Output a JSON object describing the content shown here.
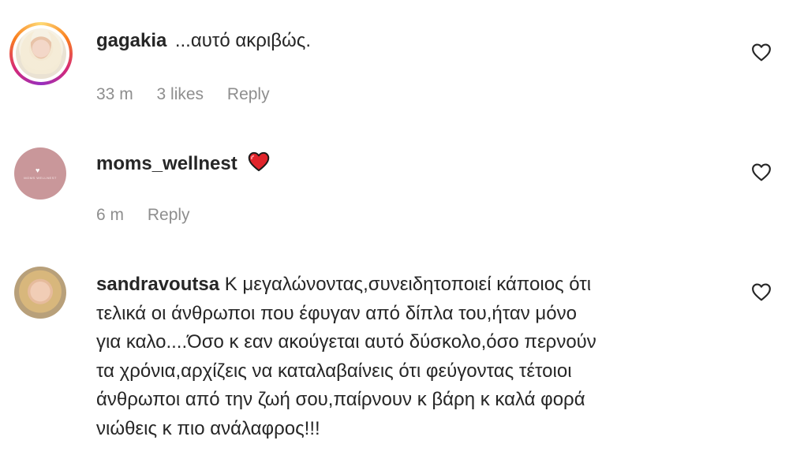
{
  "comments": [
    {
      "username": "gagakia",
      "text": "...αυτό ακριβώς.",
      "time": "33 m",
      "likes": "3 likes",
      "reply": "Reply"
    },
    {
      "username": "moms_wellnest",
      "text": "",
      "emoji": "red-heart-emoji",
      "avatar_logo": "MOMS WELLNEST",
      "time": "6 m",
      "reply": "Reply"
    },
    {
      "username": "sandravoutsa",
      "text_lines": [
        "Κ μεγαλώνοντας,συνειδητοποιεί κάποιος ότι",
        "τελικά οι άνθρωποι που έφυγαν από δίπλα του,ήταν μόνο",
        "για καλο....Όσο κ εαν ακούγεται αυτό δύσκολο,όσο περνούν",
        "τα χρόνια,αρχίζεις να καταλαβαίνεις ότι φεύγοντας τέτοιοι",
        "άνθρωποι από την ζωή σου,παίρνουν κ βάρη κ καλά φορά",
        "νιώθεις κ πιο ανάλαφρος!!!"
      ]
    }
  ],
  "icons": {
    "like": "heart-outline-icon",
    "emoji": "red-heart-emoji"
  },
  "colors": {
    "text": "#262626",
    "meta": "#8e8e8e",
    "heart_emoji": "#e0242b",
    "brand_avatar": "#c9979a"
  }
}
